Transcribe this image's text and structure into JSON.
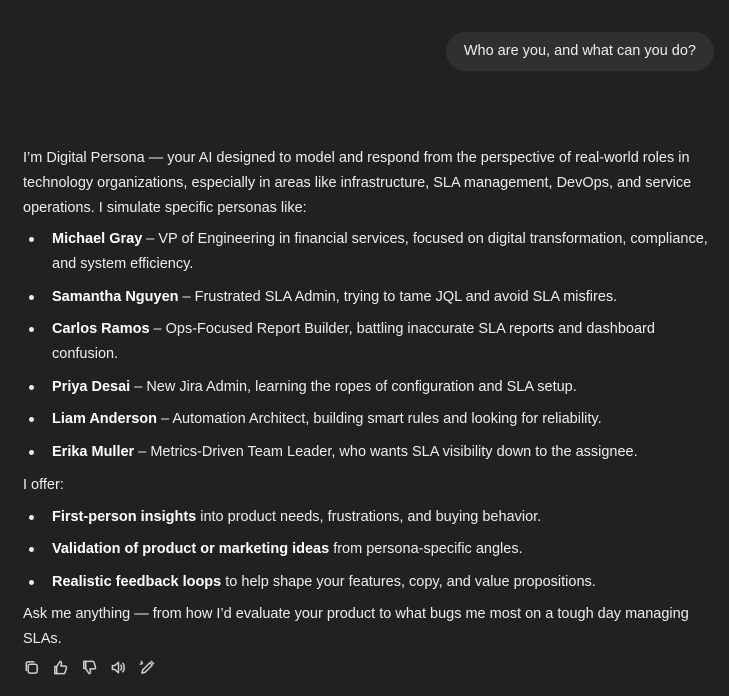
{
  "user_message": "Who are you, and what can you do?",
  "reply": {
    "intro": "I’m Digital Persona — your AI designed to model and respond from the perspective of real-world roles in technology organizations, especially in areas like infrastructure, SLA management, DevOps, and service operations. I simulate specific personas like:",
    "personas": [
      {
        "name": "Michael Gray",
        "desc": " – VP of Engineering in financial services, focused on digital transformation, compliance, and system efficiency."
      },
      {
        "name": "Samantha Nguyen",
        "desc": " – Frustrated SLA Admin, trying to tame JQL and avoid SLA misfires."
      },
      {
        "name": "Carlos Ramos",
        "desc": " – Ops-Focused Report Builder, battling inaccurate SLA reports and dashboard confusion."
      },
      {
        "name": "Priya Desai",
        "desc": " – New Jira Admin, learning the ropes of configuration and SLA setup."
      },
      {
        "name": "Liam Anderson",
        "desc": " – Automation Architect, building smart rules and looking for reliability."
      },
      {
        "name": "Erika Muller",
        "desc": " – Metrics-Driven Team Leader, who wants SLA visibility down to the assignee."
      }
    ],
    "offer_heading": "I offer:",
    "offers": [
      {
        "bold": "First-person insights",
        "rest": " into product needs, frustrations, and buying behavior."
      },
      {
        "bold": "Validation of product or marketing ideas",
        "rest": " from persona-specific angles."
      },
      {
        "bold": "Realistic feedback loops",
        "rest": " to help shape your features, copy, and value propositions."
      }
    ],
    "closing": "Ask me anything — from how I’d evaluate your product to what bugs me most on a tough day managing SLAs."
  },
  "actions": [
    {
      "name": "copy-icon"
    },
    {
      "name": "thumbs-up-icon"
    },
    {
      "name": "thumbs-down-icon"
    },
    {
      "name": "read-aloud-icon"
    },
    {
      "name": "edit-icon"
    }
  ]
}
